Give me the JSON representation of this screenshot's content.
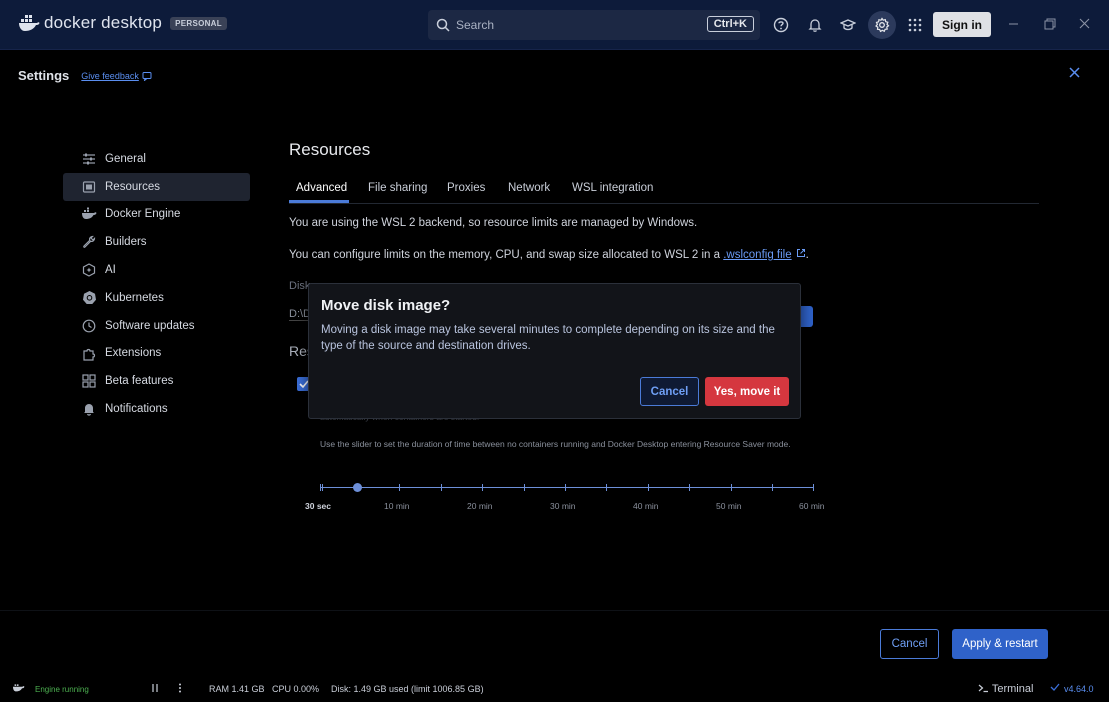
{
  "topbar": {
    "app_name": "docker desktop",
    "plan_badge": "PERSONAL",
    "search_placeholder": "Search",
    "search_shortcut": "Ctrl+K",
    "sign_in": "Sign in"
  },
  "settings": {
    "title": "Settings",
    "feedback_link": "Give feedback"
  },
  "sidebar": {
    "items": [
      {
        "label": "General",
        "icon": "sliders-icon"
      },
      {
        "label": "Resources",
        "icon": "resources-icon",
        "selected": true
      },
      {
        "label": "Docker Engine",
        "icon": "whale-icon"
      },
      {
        "label": "Builders",
        "icon": "wrench-icon"
      },
      {
        "label": "AI",
        "icon": "ai-icon"
      },
      {
        "label": "Kubernetes",
        "icon": "kubernetes-icon"
      },
      {
        "label": "Software updates",
        "icon": "clock-icon"
      },
      {
        "label": "Extensions",
        "icon": "puzzle-icon"
      },
      {
        "label": "Beta features",
        "icon": "grid-icon"
      },
      {
        "label": "Notifications",
        "icon": "bell-icon"
      }
    ]
  },
  "main": {
    "title": "Resources",
    "tabs": [
      "Advanced",
      "File sharing",
      "Proxies",
      "Network",
      "WSL integration"
    ],
    "info_line": "You are using the WSL 2 backend, so resource limits are managed by Windows.",
    "config_line_prefix": "You can configure limits on the memory, CPU, and swap size allocated to WSL 2 in a ",
    "config_link": ".wslconfig file",
    "config_line_suffix": ".",
    "disk_label_partial": "Disk",
    "disk_path_partial": "D:\\D",
    "resource_saver_partial": "Res",
    "saver_desc_partial": "automatically when containers are started.",
    "slider_desc": "Use the slider to set the duration of time between no containers running and Docker Desktop entering Resource Saver mode.",
    "slider_value_index": 0,
    "slider_labels": [
      "30 sec",
      "10 min",
      "20 min",
      "30 min",
      "40 min",
      "50 min",
      "60 min"
    ]
  },
  "dialog": {
    "title": "Move disk image?",
    "body": "Moving a disk image may take several minutes to complete depending on its size and the type of the source and destination drives.",
    "cancel": "Cancel",
    "confirm": "Yes, move it"
  },
  "footer": {
    "cancel": "Cancel",
    "apply": "Apply & restart"
  },
  "statusbar": {
    "engine_status": "Engine running",
    "ram": "RAM 1.41 GB",
    "cpu": "CPU 0.00%",
    "disk": "Disk: 1.49 GB used (limit 1006.85 GB)",
    "terminal": "Terminal",
    "version": "v4.64.0"
  },
  "colors": {
    "accent": "#2f62c9",
    "danger": "#d5373f",
    "topbar": "#0d1b3a",
    "engine_ok": "#4caf50"
  }
}
